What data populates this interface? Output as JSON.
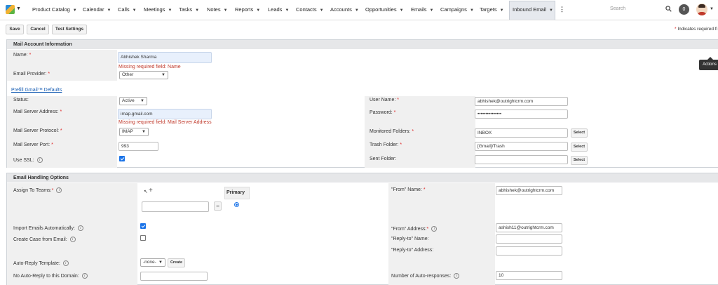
{
  "nav": {
    "items": [
      "Product Catalog",
      "Calendar",
      "Calls",
      "Meetings",
      "Tasks",
      "Notes",
      "Reports",
      "Leads",
      "Contacts",
      "Accounts",
      "Opportunities",
      "Emails",
      "Campaigns",
      "Targets",
      "Inbound Email"
    ],
    "more": "⋮",
    "search_placeholder": "Search",
    "user_badge": "0",
    "caret": "▼"
  },
  "toolbar": {
    "save": "Save",
    "cancel": "Cancel",
    "test_settings": "Test Settings",
    "required_star": "*",
    "required_note": "Indicates required fi"
  },
  "tooltip": "Actions",
  "mail_account": {
    "title": "Mail Account Information",
    "name_label": "Name:",
    "name_value": "Abhishek Sharma",
    "name_error": "Missing required field: Name",
    "provider_label": "Email Provider:",
    "provider_value": "Other",
    "prefill_link": "Prefill Gmail™ Defaults",
    "status_label": "Status:",
    "status_value": "Active",
    "server_address_label": "Mail Server Address:",
    "server_address_value": "imap.gmail.com",
    "server_address_error": "Missing required field: Mail Server Address",
    "protocol_label": "Mail Server Protocol:",
    "protocol_value": "IMAP",
    "port_label": "Mail Server Port:",
    "port_value": "993",
    "ssl_label": "Use SSL:",
    "username_label": "User Name:",
    "username_value": "abhishek@outrightcrm.com",
    "password_label": "Password:",
    "password_value": "•••••••••••••••",
    "monitored_label": "Monitored Folders:",
    "monitored_value": "INBOX",
    "trash_label": "Trash Folder:",
    "trash_value": "[Gmail]/Trash",
    "sent_label": "Sent Folder:",
    "sent_value": "",
    "select": "Select"
  },
  "email_handling": {
    "title": "Email Handling Options",
    "assign_label": "Assign To Teams:",
    "primary": "Primary",
    "cursor_glyph": "↖",
    "plus": "+",
    "minus": "−",
    "import_label": "Import Emails Automatically:",
    "case_label": "Create Case from Email:",
    "autoreply_label": "Auto-Reply Template:",
    "autoreply_value": "-none-",
    "create": "Create",
    "noautoreply_label": "No Auto-Reply to this Domain:",
    "from_name_label": "\"From\" Name:",
    "from_name_value": "abhishek@outrightcrm.com",
    "from_address_label": "\"From\" Address:",
    "from_address_value": "ashish11@outrightcrm.com",
    "replyto_name_label": "\"Reply-to\" Name:",
    "replyto_address_label": "\"Reply-to\" Address:",
    "autoresponses_label": "Number of Auto-responses:",
    "autoresponses_value": "10"
  }
}
